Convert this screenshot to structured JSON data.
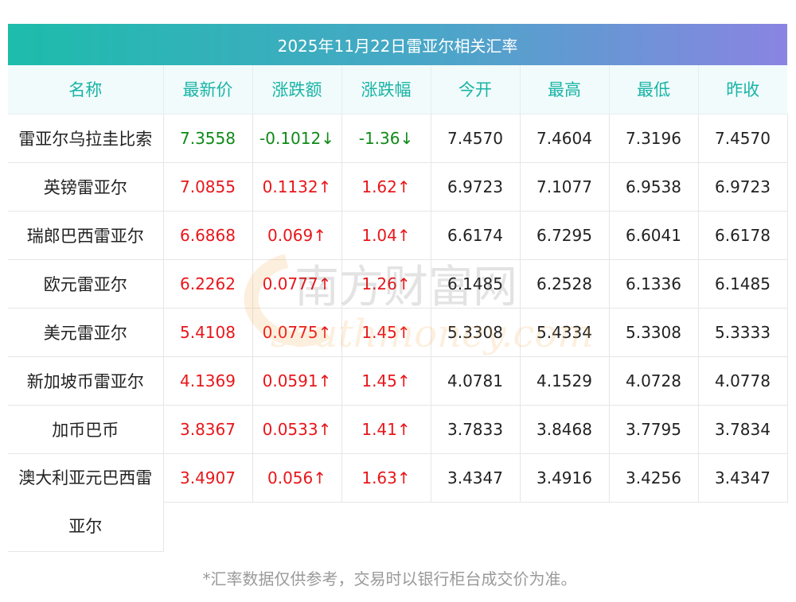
{
  "title": "2025年11月22日雷亚尔相关汇率",
  "headers": [
    "名称",
    "最新价",
    "涨跌额",
    "涨跌幅",
    "今开",
    "最高",
    "最低",
    "昨收"
  ],
  "rows": [
    {
      "name": "雷亚尔乌拉圭比索",
      "latest": "7.3558",
      "change": "-0.1012↓",
      "pct": "-1.36↓",
      "open": "7.4570",
      "high": "7.4604",
      "low": "7.3196",
      "prev": "7.4570",
      "dir": "down"
    },
    {
      "name": "英镑雷亚尔",
      "latest": "7.0855",
      "change": "0.1132↑",
      "pct": "1.62↑",
      "open": "6.9723",
      "high": "7.1077",
      "low": "6.9538",
      "prev": "6.9723",
      "dir": "up"
    },
    {
      "name": "瑞郎巴西雷亚尔",
      "latest": "6.6868",
      "change": "0.069↑",
      "pct": "1.04↑",
      "open": "6.6174",
      "high": "6.7295",
      "low": "6.6041",
      "prev": "6.6178",
      "dir": "up"
    },
    {
      "name": "欧元雷亚尔",
      "latest": "6.2262",
      "change": "0.0777↑",
      "pct": "1.26↑",
      "open": "6.1485",
      "high": "6.2528",
      "low": "6.1336",
      "prev": "6.1485",
      "dir": "up"
    },
    {
      "name": "美元雷亚尔",
      "latest": "5.4108",
      "change": "0.0775↑",
      "pct": "1.45↑",
      "open": "5.3308",
      "high": "5.4334",
      "low": "5.3308",
      "prev": "5.3333",
      "dir": "up"
    },
    {
      "name": "新加坡币雷亚尔",
      "latest": "4.1369",
      "change": "0.0591↑",
      "pct": "1.45↑",
      "open": "4.0781",
      "high": "4.1529",
      "low": "4.0728",
      "prev": "4.0778",
      "dir": "up"
    },
    {
      "name": "加币巴币",
      "latest": "3.8367",
      "change": "0.0533↑",
      "pct": "1.41↑",
      "open": "3.7833",
      "high": "3.8468",
      "low": "3.7795",
      "prev": "3.7834",
      "dir": "up"
    },
    {
      "name": "澳大利亚元巴西雷亚尔",
      "latest": "3.4907",
      "change": "0.056↑",
      "pct": "1.63↑",
      "open": "3.4347",
      "high": "3.4916",
      "low": "3.4256",
      "prev": "3.4347",
      "dir": "up"
    }
  ],
  "footnote": "*汇率数据仅供参考，交易时以银行柜台成交价为准。",
  "watermark": {
    "text_cn": "南方财富网",
    "text_en": "southmoney.com"
  },
  "colors": {
    "up": "#e8161a",
    "down": "#0f8a18",
    "header_text": "#19b4a6",
    "title_gradient_start": "#1dbcab",
    "title_gradient_end": "#8a84e2"
  }
}
